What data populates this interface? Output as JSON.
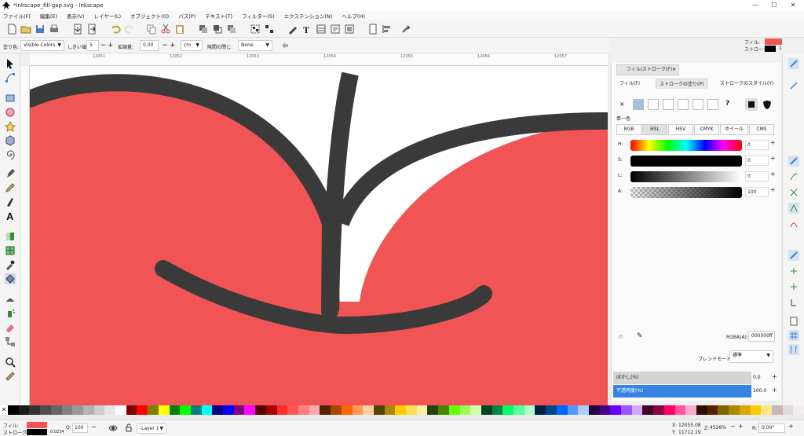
{
  "window": {
    "title": "*inkscape_fill-gap.svg - Inkscape",
    "minimize": "—",
    "maximize": "☐",
    "close": "✕"
  },
  "menu": [
    "ファイル(F)",
    "編集(E)",
    "表示(V)",
    "レイヤー(L)",
    "オブジェクト(O)",
    "パス(P)",
    "テキスト(T)",
    "フィルター(S)",
    "エクステンション(N)",
    "ヘルプ(H)"
  ],
  "toolctl": {
    "fill_label": "塗り色:",
    "fill_value": "Visible Colors",
    "threshold_label": "しきい値:",
    "threshold_value": "5",
    "grow_label": "拡縮量:",
    "grow_value": "0.00",
    "unit": "cm",
    "close_gaps_label": "隙間の閉じ:",
    "close_gaps_value": "None"
  },
  "style_indicator": {
    "fill_label": "フィル:",
    "stroke_label": "ストローク:",
    "stroke_width": "1",
    "fill_color": "#f05454",
    "stroke_color": "#000000"
  },
  "ruler": {
    "ticks": [
      "12051",
      "12052",
      "12053",
      "12054",
      "12055",
      "12056",
      "12057"
    ]
  },
  "panel": {
    "title": "フィル/ストローク(F)",
    "tab_close": "✕",
    "tabs": [
      "フィル(F)",
      "ストロークの塗り(P)",
      "ストロークのスタイル(Y)"
    ],
    "unset": "×",
    "unknown": "?",
    "section_label": "単一色",
    "color_modes": [
      "RGB",
      "HSL",
      "HSV",
      "CMYK",
      "ホイール",
      "CMS"
    ],
    "sliders": [
      {
        "name": "H:",
        "value": "0"
      },
      {
        "name": "S:",
        "value": "0"
      },
      {
        "name": "L:",
        "value": "0"
      },
      {
        "name": "A:",
        "value": "100"
      }
    ],
    "rgba_label": "RGBA(A):",
    "rgba_value": "000000ff",
    "blend_label": "ブレンドモード:",
    "blend_value": "標準",
    "blur_label": "ぼかし(%)",
    "blur_value": "0.0",
    "opacity_label": "不透明度(%)",
    "opacity_value": "100.0"
  },
  "status": {
    "fill_label": "フィル:",
    "stroke_label": "ストローク:",
    "stroke_width": "0.0234",
    "opacity_label": "O:",
    "opacity_value": "100",
    "layer": "-Layer 1",
    "x_label": "X:",
    "x_value": "12055.08",
    "y_label": "Y:",
    "y_value": "11712.19",
    "zoom_label": "Z:",
    "zoom_value": "4526%",
    "rot_label": "R:",
    "rot_value": "0.00°"
  },
  "colors": {
    "accent": "#3584e4",
    "fill": "#f05454",
    "stroke": "#3a3a3a",
    "canvas": "#ffffff"
  },
  "palette": [
    "#000000",
    "#1a1a1a",
    "#333333",
    "#4d4d4d",
    "#666666",
    "#808080",
    "#999999",
    "#b3b3b3",
    "#cccccc",
    "#e6e6e6",
    "#ffffff",
    "#800000",
    "#ff0000",
    "#808000",
    "#ffff00",
    "#008000",
    "#00ff00",
    "#008080",
    "#00ffff",
    "#000080",
    "#0000ff",
    "#800080",
    "#ff00ff",
    "#550000",
    "#aa0000",
    "#ff2a2a",
    "#ff5555",
    "#ff8080",
    "#ffaaaa",
    "#552200",
    "#aa4400",
    "#ff6600",
    "#ff9955",
    "#ffccaa",
    "#554400",
    "#aa8800",
    "#ffcc00",
    "#ffdd55",
    "#ffeeaa",
    "#224400",
    "#448800",
    "#66ff00",
    "#99ff55",
    "#ccffaa",
    "#004422",
    "#008844",
    "#00ff66",
    "#55ff99",
    "#aaffcc",
    "#002244",
    "#004488",
    "#0066ff",
    "#5599ff",
    "#aaccff",
    "#220044",
    "#440088",
    "#6600ff",
    "#9955ff",
    "#ccaaff",
    "#440022",
    "#880044",
    "#ff0066",
    "#ff5599",
    "#ffaacc",
    "#2b1100",
    "#552200",
    "#806600",
    "#aa8800",
    "#d4aa00",
    "#ffcc00",
    "#ffe680",
    "#c8b7b7",
    "#e3dbdb",
    "#f2eeee"
  ]
}
